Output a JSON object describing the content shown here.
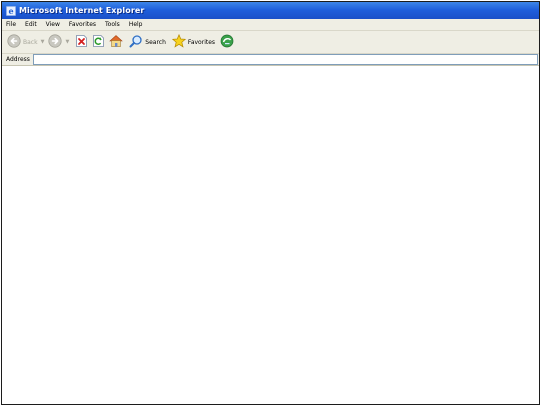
{
  "window": {
    "title": "Microsoft Internet Explorer"
  },
  "menubar": {
    "items": [
      "File",
      "Edit",
      "View",
      "Favorites",
      "Tools",
      "Help"
    ]
  },
  "toolbar": {
    "back_label": "Back",
    "search_label": "Search",
    "favorites_label": "Favorites"
  },
  "addressbar": {
    "label": "Address",
    "value": ""
  },
  "colors": {
    "titlebar": "#1f5fdc",
    "chrome": "#efeee4"
  }
}
